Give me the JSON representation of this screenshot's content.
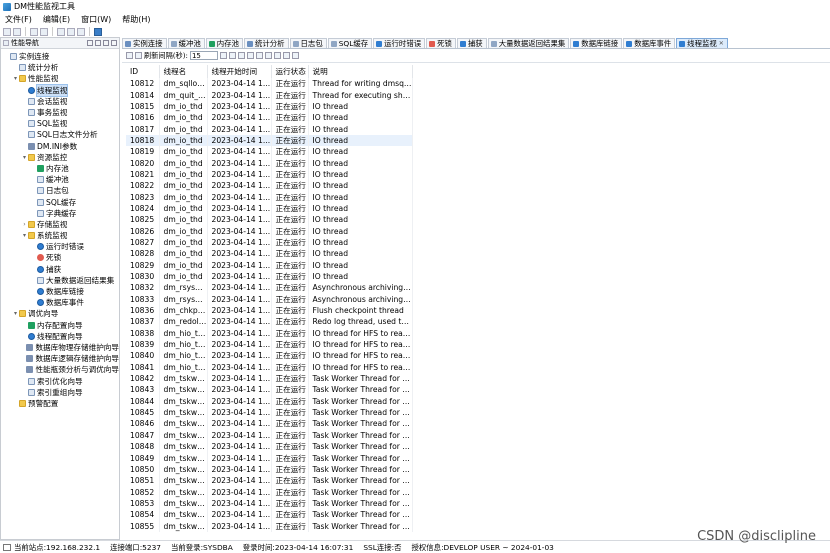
{
  "window": {
    "title": "DM性能监视工具"
  },
  "menu": [
    "文件(F)",
    "编辑(E)",
    "窗口(W)",
    "帮助(H)"
  ],
  "nav": {
    "title": "性能导航",
    "tree": [
      {
        "label": "实例连接",
        "level": 0,
        "icon": "page"
      },
      {
        "label": "统计分析",
        "level": 1,
        "icon": "page"
      },
      {
        "label": "性能监视",
        "level": 1,
        "icon": "folder",
        "twisty": "▾"
      },
      {
        "label": "线程监视",
        "level": 2,
        "icon": "gear",
        "selected": true
      },
      {
        "label": "会话监视",
        "level": 2,
        "icon": "page"
      },
      {
        "label": "事务监视",
        "level": 2,
        "icon": "page"
      },
      {
        "label": "SQL监视",
        "level": 2,
        "icon": "page"
      },
      {
        "label": "SQL日志文件分析",
        "level": 2,
        "icon": "page"
      },
      {
        "label": "DM.INI参数",
        "level": 2,
        "icon": "db"
      },
      {
        "label": "资源监控",
        "level": 2,
        "icon": "folder",
        "twisty": "▾"
      },
      {
        "label": "内存池",
        "level": 3,
        "icon": "mem"
      },
      {
        "label": "缓冲池",
        "level": 3,
        "icon": "page"
      },
      {
        "label": "日志包",
        "level": 3,
        "icon": "page"
      },
      {
        "label": "SQL缓存",
        "level": 3,
        "icon": "page"
      },
      {
        "label": "字典缓存",
        "level": 3,
        "icon": "page"
      },
      {
        "label": "存储监视",
        "level": 2,
        "icon": "folder",
        "twisty": "›"
      },
      {
        "label": "系统监视",
        "level": 2,
        "icon": "folder",
        "twisty": "▾"
      },
      {
        "label": "运行时错误",
        "level": 3,
        "icon": "gear"
      },
      {
        "label": "死锁",
        "level": 3,
        "icon": "red"
      },
      {
        "label": "捕获",
        "level": 3,
        "icon": "gear"
      },
      {
        "label": "大量数据返回结果集",
        "level": 3,
        "icon": "page"
      },
      {
        "label": "数据库链接",
        "level": 3,
        "icon": "gear"
      },
      {
        "label": "数据库事件",
        "level": 3,
        "icon": "gear"
      },
      {
        "label": "调优向导",
        "level": 1,
        "icon": "folder",
        "twisty": "▾"
      },
      {
        "label": "内存配置向导",
        "level": 2,
        "icon": "mem"
      },
      {
        "label": "线程配置向导",
        "level": 2,
        "icon": "gear"
      },
      {
        "label": "数据库物理存储维护向导",
        "level": 2,
        "icon": "db"
      },
      {
        "label": "数据库逻辑存储维护向导",
        "level": 2,
        "icon": "db"
      },
      {
        "label": "性能瓶颈分析与调优向导",
        "level": 2,
        "icon": "db"
      },
      {
        "label": "索引优化向导",
        "level": 2,
        "icon": "page"
      },
      {
        "label": "索引重组向导",
        "level": 2,
        "icon": "page"
      },
      {
        "label": "预警配置",
        "level": 1,
        "icon": "folder"
      }
    ]
  },
  "tabs": [
    {
      "label": "实例连接",
      "color": "#6a8fc0"
    },
    {
      "label": "缓冲池",
      "color": "#8fa6c4"
    },
    {
      "label": "内存池",
      "color": "#20a060"
    },
    {
      "label": "统计分析",
      "color": "#6a8fc0"
    },
    {
      "label": "日志包",
      "color": "#8fa6c4"
    },
    {
      "label": "SQL缓存",
      "color": "#8fa6c4"
    },
    {
      "label": "运行时错误",
      "color": "#2f7dd1"
    },
    {
      "label": "死锁",
      "color": "#e15a4f"
    },
    {
      "label": "捕获",
      "color": "#2f7dd1"
    },
    {
      "label": "大量数据返回结果集",
      "color": "#8fa6c4"
    },
    {
      "label": "数据库链接",
      "color": "#2f7dd1"
    },
    {
      "label": "数据库事件",
      "color": "#2f7dd1"
    },
    {
      "label": "线程监视",
      "color": "#2f7dd1",
      "active": true
    }
  ],
  "filter": {
    "label": "刷新间隔(秒):",
    "value": "15"
  },
  "table": {
    "headers": [
      "ID",
      "线程名",
      "线程开始时间",
      "运行状态",
      "说明"
    ],
    "rows": [
      [
        "10812",
        "dm_sqllog...",
        "2023-04-14 1...",
        "正在运行",
        "Thread for writing dmsql ..."
      ],
      [
        "10814",
        "dm_quit_t...",
        "2023-04-14 1...",
        "正在运行",
        "Thread for executing shut..."
      ],
      [
        "10815",
        "dm_io_thd",
        "2023-04-14 1...",
        "正在运行",
        "IO thread"
      ],
      [
        "10816",
        "dm_io_thd",
        "2023-04-14 1...",
        "正在运行",
        "IO thread"
      ],
      [
        "10817",
        "dm_io_thd",
        "2023-04-14 1...",
        "正在运行",
        "IO thread"
      ],
      [
        "10818",
        "dm_io_thd",
        "2023-04-14 1...",
        "正在运行",
        "IO thread"
      ],
      [
        "10819",
        "dm_io_thd",
        "2023-04-14 1...",
        "正在运行",
        "IO thread"
      ],
      [
        "10820",
        "dm_io_thd",
        "2023-04-14 1...",
        "正在运行",
        "IO thread"
      ],
      [
        "10821",
        "dm_io_thd",
        "2023-04-14 1...",
        "正在运行",
        "IO thread"
      ],
      [
        "10822",
        "dm_io_thd",
        "2023-04-14 1...",
        "正在运行",
        "IO thread"
      ],
      [
        "10823",
        "dm_io_thd",
        "2023-04-14 1...",
        "正在运行",
        "IO thread"
      ],
      [
        "10824",
        "dm_io_thd",
        "2023-04-14 1...",
        "正在运行",
        "IO thread"
      ],
      [
        "10825",
        "dm_io_thd",
        "2023-04-14 1...",
        "正在运行",
        "IO thread"
      ],
      [
        "10826",
        "dm_io_thd",
        "2023-04-14 1...",
        "正在运行",
        "IO thread"
      ],
      [
        "10827",
        "dm_io_thd",
        "2023-04-14 1...",
        "正在运行",
        "IO thread"
      ],
      [
        "10828",
        "dm_io_thd",
        "2023-04-14 1...",
        "正在运行",
        "IO thread"
      ],
      [
        "10829",
        "dm_io_thd",
        "2023-04-14 1...",
        "正在运行",
        "IO thread"
      ],
      [
        "10830",
        "dm_io_thd",
        "2023-04-14 1...",
        "正在运行",
        "IO thread"
      ],
      [
        "10832",
        "dm_rsyswr...",
        "2023-04-14 1...",
        "正在运行",
        "Asynchronous archiving t..."
      ],
      [
        "10833",
        "dm_rsyswr...",
        "2023-04-14 1...",
        "正在运行",
        "Asynchronous archiving t..."
      ],
      [
        "10836",
        "dm_chkpn...",
        "2023-04-14 1...",
        "正在运行",
        "Flush checkpoint thread"
      ],
      [
        "10837",
        "dm_redolo...",
        "2023-04-14 1...",
        "正在运行",
        "Redo log thread, used to f..."
      ],
      [
        "10838",
        "dm_hio_thd",
        "2023-04-14 1...",
        "正在运行",
        "IO thread for HFS to read ..."
      ],
      [
        "10839",
        "dm_hio_thd",
        "2023-04-14 1...",
        "正在运行",
        "IO thread for HFS to read ..."
      ],
      [
        "10840",
        "dm_hio_thd",
        "2023-04-14 1...",
        "正在运行",
        "IO thread for HFS to read ..."
      ],
      [
        "10841",
        "dm_hio_thd",
        "2023-04-14 1...",
        "正在运行",
        "IO thread for HFS to read ..."
      ],
      [
        "10842",
        "dm_tskwrk...",
        "2023-04-14 1...",
        "正在运行",
        "Task Worker Thread for S..."
      ],
      [
        "10843",
        "dm_tskwrk...",
        "2023-04-14 1...",
        "正在运行",
        "Task Worker Thread for S..."
      ],
      [
        "10844",
        "dm_tskwrk...",
        "2023-04-14 1...",
        "正在运行",
        "Task Worker Thread for S..."
      ],
      [
        "10845",
        "dm_tskwrk...",
        "2023-04-14 1...",
        "正在运行",
        "Task Worker Thread for S..."
      ],
      [
        "10846",
        "dm_tskwrk...",
        "2023-04-14 1...",
        "正在运行",
        "Task Worker Thread for S..."
      ],
      [
        "10847",
        "dm_tskwrk...",
        "2023-04-14 1...",
        "正在运行",
        "Task Worker Thread for S..."
      ],
      [
        "10848",
        "dm_tskwrk...",
        "2023-04-14 1...",
        "正在运行",
        "Task Worker Thread for S..."
      ],
      [
        "10849",
        "dm_tskwrk...",
        "2023-04-14 1...",
        "正在运行",
        "Task Worker Thread for S..."
      ],
      [
        "10850",
        "dm_tskwrk...",
        "2023-04-14 1...",
        "正在运行",
        "Task Worker Thread for S..."
      ],
      [
        "10851",
        "dm_tskwrk...",
        "2023-04-14 1...",
        "正在运行",
        "Task Worker Thread for S..."
      ],
      [
        "10852",
        "dm_tskwrk...",
        "2023-04-14 1...",
        "正在运行",
        "Task Worker Thread for S..."
      ],
      [
        "10853",
        "dm_tskwrk...",
        "2023-04-14 1...",
        "正在运行",
        "Task Worker Thread for S..."
      ],
      [
        "10854",
        "dm_tskwrk...",
        "2023-04-14 1...",
        "正在运行",
        "Task Worker Thread for S..."
      ],
      [
        "10855",
        "dm_tskwrk...",
        "2023-04-14 1...",
        "正在运行",
        "Task Worker Thread for S..."
      ]
    ],
    "selected_row": 5
  },
  "status": {
    "site": "当前站点:192.168.232.1",
    "conn": "连接端口:5237",
    "user": "当前登录:SYSDBA",
    "login_time": "登录时间:2023-04-14 16:07:31",
    "ssl": "SSL连接:否",
    "license": "授权信息:DEVELOP USER ~ 2024-01-03"
  },
  "watermark": "CSDN @disclipline"
}
